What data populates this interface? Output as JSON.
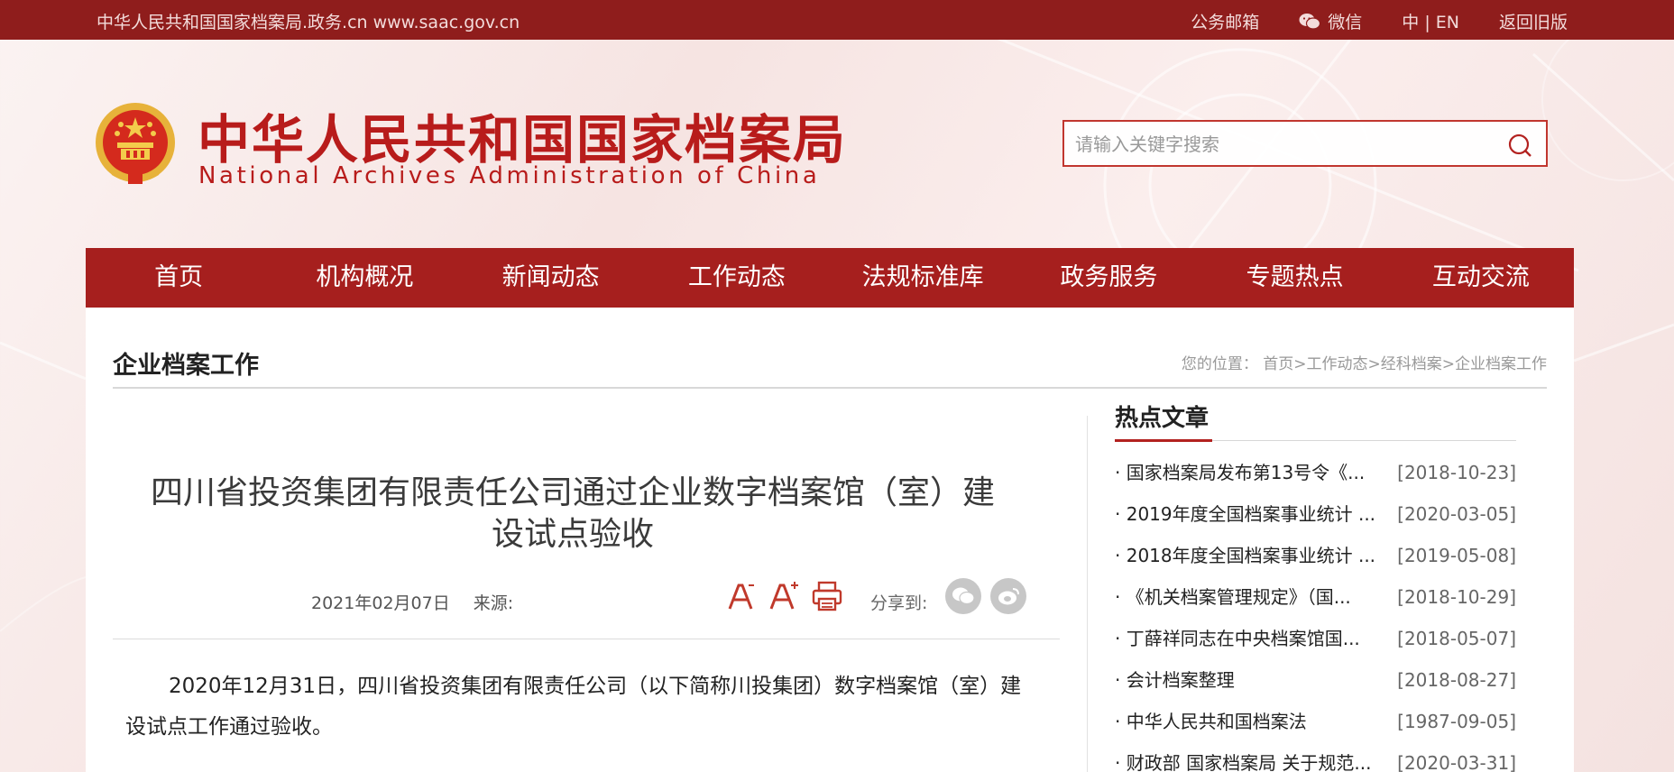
{
  "topbar": {
    "site": "中华人民共和国国家档案局.政务.cn www.saac.gov.cn",
    "mail": "公务邮箱",
    "wechat": "微信",
    "language": "中 | EN",
    "old_version": "返回旧版"
  },
  "header": {
    "title_cn": "中华人民共和国国家档案局",
    "title_en": "National Archives Administration of China",
    "search_placeholder": "请输入关键字搜索"
  },
  "nav": [
    "首页",
    "机构概况",
    "新闻动态",
    "工作动态",
    "法规标准库",
    "政务服务",
    "专题热点",
    "互动交流"
  ],
  "section": {
    "title": "企业档案工作",
    "breadcrumb_label": "您的位置：",
    "breadcrumb": [
      "首页",
      "工作动态",
      "经科档案",
      "企业档案工作"
    ],
    "separator": ">"
  },
  "article": {
    "title": "四川省投资集团有限责任公司通过企业数字档案馆（室）建设试点验收",
    "date": "2021年02月07日",
    "source_label": "来源:",
    "share_label": "分享到:",
    "body": "2020年12月31日，四川省投资集团有限责任公司（以下简称川投集团）数字档案馆（室）建设试点工作通过验收。"
  },
  "hot": {
    "title": "热点文章",
    "items": [
      {
        "text": "· 国家档案局发布第13号令《...",
        "date": "[2018-10-23]"
      },
      {
        "text": "· 2019年度全国档案事业统计 ...",
        "date": "[2020-03-05]"
      },
      {
        "text": "· 2018年度全国档案事业统计 ...",
        "date": "[2019-05-08]"
      },
      {
        "text": "· 《机关档案管理规定》（国...",
        "date": "[2018-10-29]"
      },
      {
        "text": "· 丁薛祥同志在中央档案馆国...",
        "date": "[2018-05-07]"
      },
      {
        "text": "· 会计档案整理",
        "date": "[2018-08-27]"
      },
      {
        "text": "· 中华人民共和国档案法",
        "date": "[1987-09-05]"
      },
      {
        "text": "· 财政部 国家档案局 关于规范...",
        "date": "[2020-03-31]"
      }
    ]
  },
  "colors": {
    "brand_red": "#a61f1e",
    "topbar_red": "#8f1d1c",
    "title_red": "#b81c1b"
  }
}
